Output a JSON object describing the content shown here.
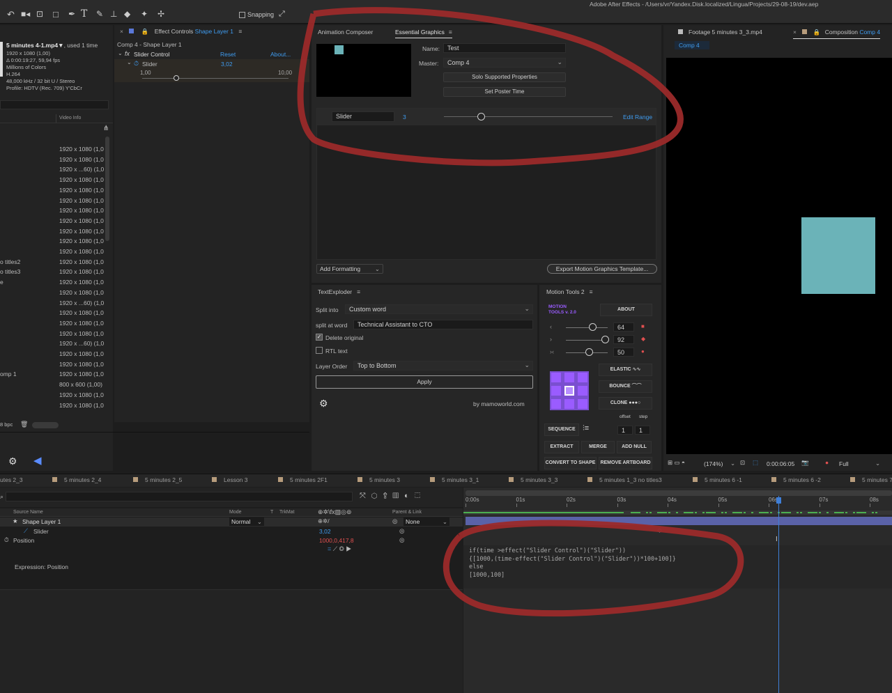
{
  "window": {
    "title": "Adobe After Effects - /Users/vr/Yandex.Disk.localized/Lingua/Projects/29-08-19/dev.aep"
  },
  "toolbar": {
    "snapping_label": "Snapping"
  },
  "project": {
    "item_name": "5 minutes 4-1.mp4▼",
    "used": ", used 1 time",
    "info": [
      "1920 x 1080 (1,00)",
      "Δ 0:00:19:27, 59,94 fps",
      "Millions of Colors",
      "H.264",
      "48,000 kHz / 32 bit U / Stereo",
      "Profile: HDTV (Rec. 709) Y'CbCr"
    ],
    "video_info_header": "Video Info",
    "rows": [
      {
        "name": "",
        "res": "1920 x 1080 (1,0"
      },
      {
        "name": "",
        "res": "1920 x 1080 (1,0"
      },
      {
        "name": "",
        "res": "1920 x ...60) (1,0"
      },
      {
        "name": "",
        "res": "1920 x 1080 (1,0"
      },
      {
        "name": "",
        "res": "1920 x 1080 (1,0"
      },
      {
        "name": "",
        "res": "1920 x 1080 (1,0"
      },
      {
        "name": "",
        "res": "1920 x 1080 (1,0"
      },
      {
        "name": "",
        "res": "1920 x 1080 (1,0"
      },
      {
        "name": "",
        "res": "1920 x 1080 (1,0"
      },
      {
        "name": "",
        "res": "1920 x 1080 (1,0"
      },
      {
        "name": "",
        "res": "1920 x 1080 (1,0"
      },
      {
        "name": "o titles2",
        "res": "1920 x 1080 (1,0"
      },
      {
        "name": "o titles3",
        "res": "1920 x 1080 (1,0"
      },
      {
        "name": "e",
        "res": "1920 x 1080 (1,0"
      },
      {
        "name": "",
        "res": "1920 x 1080 (1,0"
      },
      {
        "name": "",
        "res": "1920 x ...60) (1,0"
      },
      {
        "name": "",
        "res": "1920 x 1080 (1,0"
      },
      {
        "name": "",
        "res": "1920 x 1080 (1,0"
      },
      {
        "name": "",
        "res": "1920 x 1080 (1,0"
      },
      {
        "name": "",
        "res": "1920 x ...60) (1,0"
      },
      {
        "name": "",
        "res": "1920 x 1080 (1,0"
      },
      {
        "name": "",
        "res": "1920 x 1080 (1,0"
      },
      {
        "name": "omp 1",
        "res": "1920 x 1080 (1,0"
      },
      {
        "name": "",
        "res": "800 x 600 (1,00)"
      },
      {
        "name": "",
        "res": "1920 x 1080 (1,0"
      },
      {
        "name": "",
        "res": "1920 x 1080 (1,0"
      }
    ],
    "bpc": "8 bpc"
  },
  "effect_controls": {
    "tab_prefix": "Effect Controls",
    "tab_layer": "Shape Layer 1",
    "breadcrumb": "Comp 4 - Shape Layer 1",
    "effect_name": "Slider Control",
    "reset": "Reset",
    "about": "About...",
    "prop_name": "Slider",
    "prop_value": "3,02",
    "range_min": "1,00",
    "range_max": "10,00"
  },
  "essential_graphics": {
    "tab_animation": "Animation Composer",
    "tab_eg": "Essential Graphics",
    "name_label": "Name:",
    "name_value": "Test",
    "master_label": "Master:",
    "master_value": "Comp 4",
    "solo_button": "Solo Supported Properties",
    "poster_button": "Set Poster Time",
    "slider_name": "Slider",
    "slider_value": "3",
    "edit_range": "Edit Range",
    "add_formatting": "Add Formatting",
    "export_button": "Export Motion Graphics Template..."
  },
  "text_exploder": {
    "title": "TextExploder",
    "split_into_label": "Split into",
    "split_into_value": "Custom word",
    "split_at_label": "split at word",
    "split_at_value": "Technical Assistant to CTO",
    "delete_original": "Delete original",
    "rtl_text": "RTL text",
    "layer_order_label": "Layer Order",
    "layer_order_value": "Top to Bottom",
    "apply": "Apply",
    "credit": "by mamoworld.com"
  },
  "motion_tools": {
    "title": "Motion Tools 2",
    "logo_line1": "MOTION",
    "logo_line2": "TOOLS v. 2.0",
    "about": "ABOUT",
    "sliders": [
      {
        "value": "64",
        "level": 0.6
      },
      {
        "value": "92",
        "level": 0.92
      },
      {
        "value": "50",
        "level": 0.5
      }
    ],
    "elastic": "ELASTIC",
    "bounce": "BOUNCE",
    "clone": "CLONE",
    "offset_label": "offset",
    "step_label": "step",
    "sequence": "SEQUENCE",
    "offset_value": "1",
    "step_value": "1",
    "extract": "EXTRACT",
    "merge": "MERGE",
    "add_null": "ADD NULL",
    "convert_to_shape": "CONVERT TO SHAPE",
    "remove_artboard": "REMOVE ARTBOARD",
    "accent_color": "#9a5cff"
  },
  "viewer": {
    "footage_tab": "Footage 5 minutes 3_3.mp4",
    "comp_tab_prefix": "Composition",
    "comp_tab_name": "Comp 4",
    "comp_chip": "Comp 4",
    "zoom": "(174%)",
    "timecode": "0:00:06:05",
    "resolution": "Full",
    "shape_color": "#6bb3b8"
  },
  "timeline": {
    "tabs": [
      "utes 2_3",
      "5 minutes 2_4",
      "5 minutes 2_5",
      "Lesson 3",
      "5 minutes 2F1",
      "5 minutes 3",
      "5 minutes 3_1",
      "5 minutes 3_3",
      "5 minutes 1_3 no titles3",
      "5 minutes 6 -1",
      "5 minutes 6 -2",
      "5 minutes 7"
    ],
    "col_source": "Source Name",
    "col_mode": "Mode",
    "col_t": "T",
    "col_trkmat": "TrkMat",
    "col_parent": "Parent & Link",
    "layer_name": "Shape Layer 1",
    "mode_value": "Normal",
    "parent_value": "None",
    "slider_name": "Slider",
    "slider_value": "3,02",
    "position_name": "Position",
    "position_value": "1000,0,417,8",
    "expression_label": "Expression: Position",
    "ruler": [
      "0:00s",
      "01s",
      "02s",
      "03s",
      "04s",
      "05s",
      "06s",
      "07s",
      "08s"
    ],
    "expression_lines": [
      "if(time >effect(\"Slider Control\")(\"Slider\"))",
      "{[1000,(time-effect(\"Slider Control\")(\"Slider\"))*100+100]}",
      "else",
      "[1000,100]"
    ]
  }
}
